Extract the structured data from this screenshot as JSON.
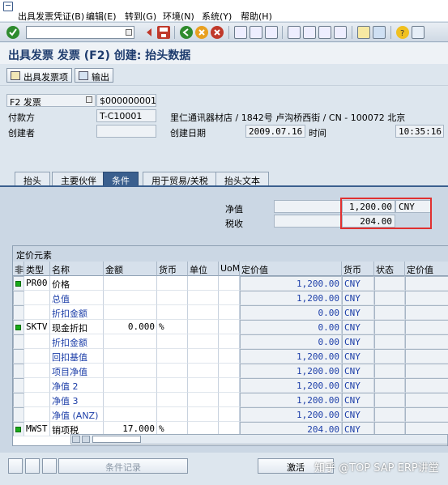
{
  "menu": {
    "items": [
      "出具发票凭证(B)",
      "编辑(E)",
      "转到(G)",
      "环境(N)",
      "系统(Y)",
      "帮助(H)"
    ]
  },
  "title": "出具发票 发票 (F2) 创建: 抬头数据",
  "app_toolbar": {
    "items_button": "出具发票项",
    "output_button": "输出"
  },
  "header": {
    "doc_type": "F2 发票",
    "doc_number": "$000000001",
    "payer_label": "付款方",
    "payer_value": "T-C10001",
    "payer_address": "里仁通讯器材店 / 1842号 卢沟桥西街 / CN - 100072 北京",
    "created_by_label": "创建者",
    "created_by_value": "",
    "created_on_label": "创建日期",
    "created_on_value": "2009.07.16",
    "time_label": "时间",
    "time_value": "10:35:16"
  },
  "tabs": [
    "抬头",
    "主要伙伴",
    "条件",
    "用于贸易/关税",
    "抬头文本"
  ],
  "summary": {
    "net_label": "净值",
    "net_value": "1,200.00",
    "net_currency": "CNY",
    "tax_label": "税收",
    "tax_value": "204.00"
  },
  "pricing": {
    "caption": "定价元素",
    "columns": [
      "非",
      "类型",
      "名称",
      "金额",
      "货币",
      "单位",
      "UoM",
      "定价值",
      "货币",
      "状态",
      "定价值"
    ],
    "rows": [
      {
        "status": true,
        "type": "PR00",
        "name": "价格",
        "amount": "",
        "currency": "",
        "value": "1,200.00",
        "cur2": "CNY"
      },
      {
        "status": false,
        "type": "",
        "name": "总值",
        "amount": "",
        "currency": "",
        "value": "1,200.00",
        "cur2": "CNY"
      },
      {
        "status": false,
        "type": "",
        "name": "折扣金额",
        "amount": "",
        "currency": "",
        "value": "0.00",
        "cur2": "CNY"
      },
      {
        "status": true,
        "type": "SKTV",
        "name": "现金折扣",
        "amount": "0.000",
        "currency": "%",
        "value": "0.00",
        "cur2": "CNY"
      },
      {
        "status": false,
        "type": "",
        "name": "折扣金额",
        "amount": "",
        "currency": "",
        "value": "0.00",
        "cur2": "CNY"
      },
      {
        "status": false,
        "type": "",
        "name": "回扣基值",
        "amount": "",
        "currency": "",
        "value": "1,200.00",
        "cur2": "CNY"
      },
      {
        "status": false,
        "type": "",
        "name": "项目净值",
        "amount": "",
        "currency": "",
        "value": "1,200.00",
        "cur2": "CNY"
      },
      {
        "status": false,
        "type": "",
        "name": "净值 2",
        "amount": "",
        "currency": "",
        "value": "1,200.00",
        "cur2": "CNY"
      },
      {
        "status": false,
        "type": "",
        "name": "净值 3",
        "amount": "",
        "currency": "",
        "value": "1,200.00",
        "cur2": "CNY"
      },
      {
        "status": false,
        "type": "",
        "name": "净值 (ANZ)",
        "amount": "",
        "currency": "",
        "value": "1,200.00",
        "cur2": "CNY"
      },
      {
        "status": true,
        "type": "MWST",
        "name": "销项税",
        "amount": "17.000",
        "currency": "%",
        "value": "204.00",
        "cur2": "CNY"
      }
    ]
  },
  "bottom": {
    "condition_record": "条件记录",
    "activate": "激活",
    "watermark": "知乎 @TOP SAP ERP讲堂"
  },
  "colors": {
    "accent": "#3a5f8e",
    "highlight_box": "#e03030",
    "value_blue": "#1c3ea8"
  }
}
